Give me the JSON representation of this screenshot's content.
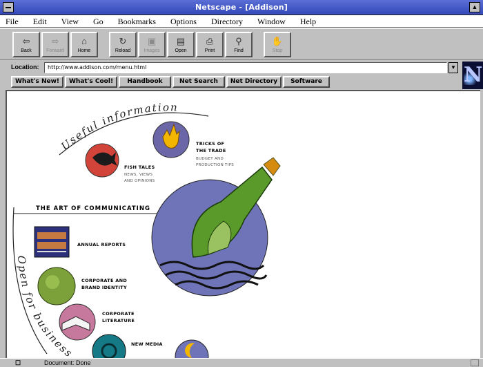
{
  "window": {
    "title": "Netscape - [Addison]"
  },
  "menu": {
    "items": [
      "File",
      "Edit",
      "View",
      "Go",
      "Bookmarks",
      "Options",
      "Directory",
      "Window",
      "Help"
    ]
  },
  "toolbar": {
    "buttons": [
      {
        "label": "Back",
        "icon": "back-arrow-icon",
        "glyph": "⇦"
      },
      {
        "label": "Forward",
        "icon": "forward-arrow-icon",
        "glyph": "⇨"
      },
      {
        "label": "Home",
        "icon": "home-icon",
        "glyph": "⌂"
      },
      {
        "label": "Reload",
        "icon": "reload-icon",
        "glyph": "↻"
      },
      {
        "label": "Images",
        "icon": "images-icon",
        "glyph": "▣"
      },
      {
        "label": "Open",
        "icon": "open-icon",
        "glyph": "▤"
      },
      {
        "label": "Print",
        "icon": "print-icon",
        "glyph": "⎙"
      },
      {
        "label": "Find",
        "icon": "find-icon",
        "glyph": "⚲"
      },
      {
        "label": "Stop",
        "icon": "stop-icon",
        "glyph": "✋"
      }
    ]
  },
  "location": {
    "label": "Location:",
    "url": "http://www.addison.com/menu.html"
  },
  "directory_buttons": [
    "What's New!",
    "What's Cool!",
    "Handbook",
    "Net Search",
    "Net Directory",
    "Software"
  ],
  "page": {
    "arc_top": "Useful information",
    "arc_left": "Open for business",
    "section_heading": "THE ART OF COMMUNICATING",
    "items": {
      "tricks": {
        "title1": "TRICKS OF",
        "title2": "THE TRADE",
        "sub1": "BUDGET AND",
        "sub2": "PRODUCTION TIPS"
      },
      "fish": {
        "title": "FISH TALES",
        "sub1": "NEWS, VIEWS",
        "sub2": "AND OPINIONS"
      },
      "annual": {
        "title": "ANNUAL REPORTS"
      },
      "identity": {
        "title1": "CORPORATE AND",
        "title2": "BRAND IDENTITY"
      },
      "literature": {
        "title1": "CORPORATE",
        "title2": "LITERATURE"
      },
      "newmedia": {
        "title": "NEW MEDIA"
      }
    }
  },
  "status": {
    "icon": "document-icon",
    "text": "Document: Done"
  },
  "colors": {
    "title_bar": "#3347b8",
    "circle_blue": "#6f74b8",
    "bottle_green": "#5a9a2b",
    "circle_red": "#d2433a",
    "circle_purple": "#6a66a8"
  }
}
